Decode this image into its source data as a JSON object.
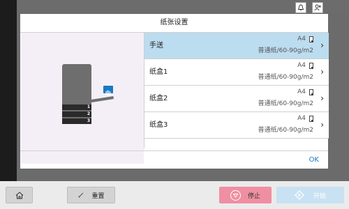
{
  "dialog": {
    "title": "纸张设置",
    "ok_label": "OK"
  },
  "preview": {
    "tray_numbers": [
      "1",
      "2",
      "3"
    ]
  },
  "paper_sources": [
    {
      "name": "手送",
      "size": "A4",
      "type": "普通纸/60-90g/m2",
      "selected": true
    },
    {
      "name": "纸盒1",
      "size": "A4",
      "type": "普通纸/60-90g/m2",
      "selected": false
    },
    {
      "name": "纸盒2",
      "size": "A4",
      "type": "普通纸/60-90g/m2",
      "selected": false
    },
    {
      "name": "纸盒3",
      "size": "A4",
      "type": "普通纸/60-90g/m2",
      "selected": false
    }
  ],
  "bottom_bar": {
    "reset_label": "重置",
    "stop_label": "停止",
    "start_label": "开始"
  },
  "icons": {
    "bell": "bell-icon",
    "user": "user-status-icon",
    "home": "home-icon",
    "reset": "reset-icon",
    "stop": "stop-icon",
    "start": "start-icon",
    "paper": "paper-portrait-icon",
    "chevron": "chevron-right-icon",
    "hand": "manual-feed-hand-icon"
  },
  "colors": {
    "accent": "#1a79c4",
    "selected_row": "#bcdcf0",
    "stop_button": "#ef8fa1",
    "start_button": "#c8e2f3"
  }
}
